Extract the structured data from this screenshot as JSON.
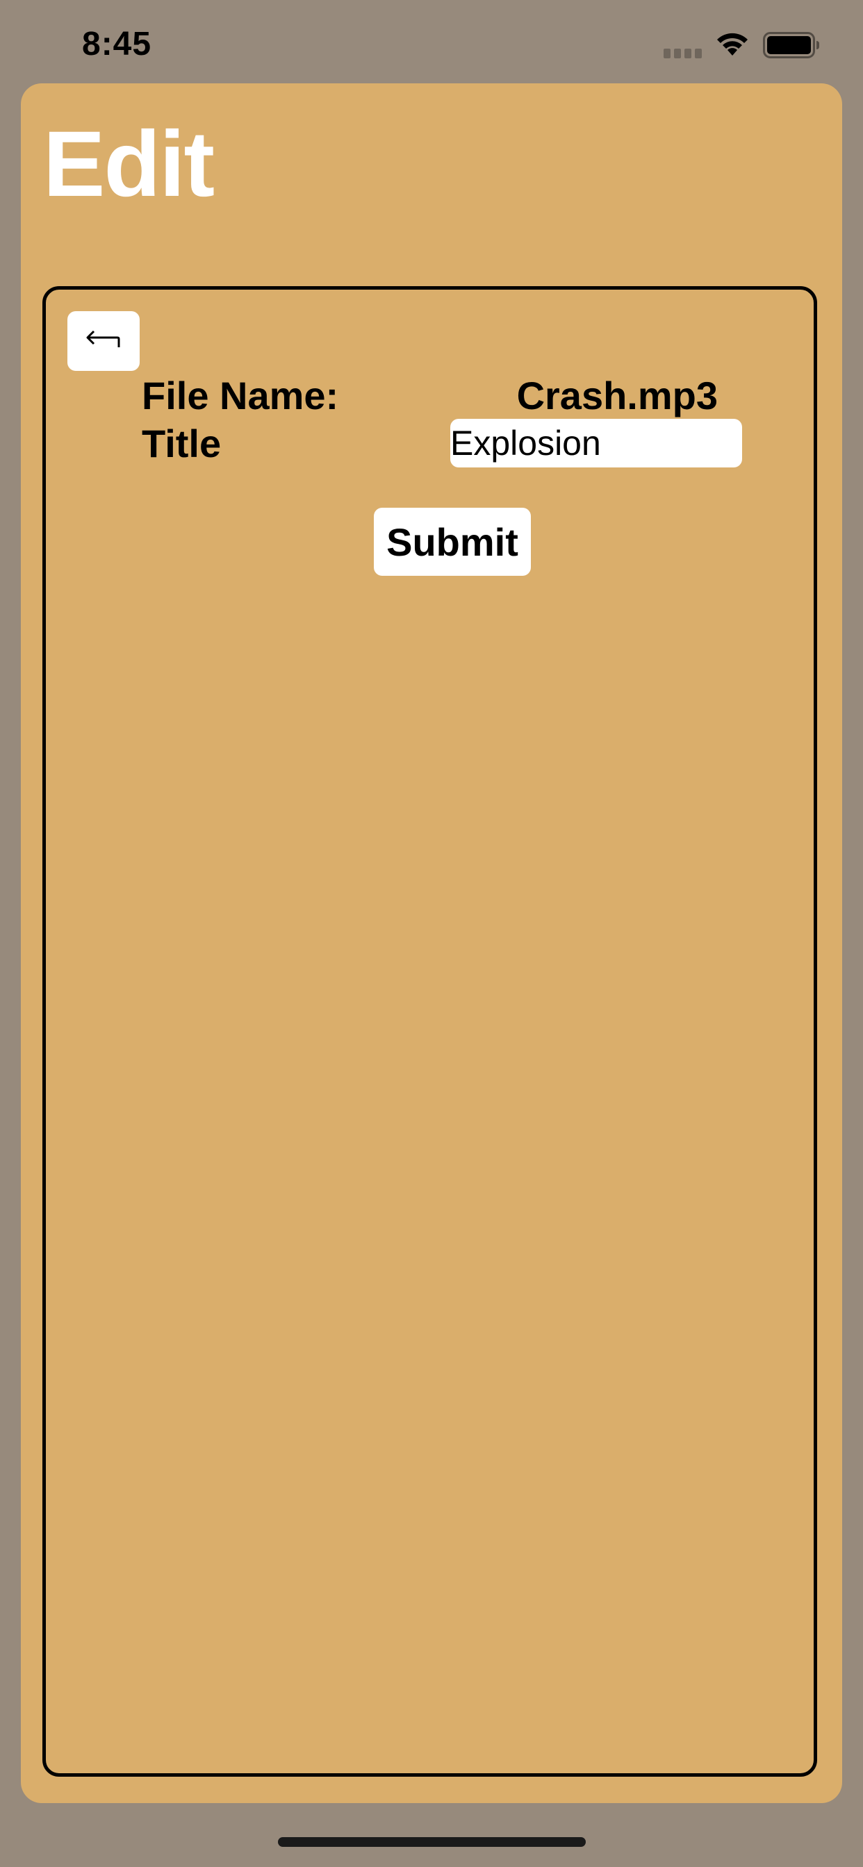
{
  "status_bar": {
    "time": "8:45"
  },
  "screen": {
    "title": "Edit"
  },
  "form": {
    "back_icon": "return-arrow-icon",
    "file_name_label": "File Name:",
    "file_name_value": "Crash.mp3",
    "title_label": "Title",
    "title_value": "Explosion",
    "submit_label": "Submit"
  },
  "colors": {
    "background": "#978a7c",
    "sheet": "#daae6b",
    "title_text": "#ffffff"
  }
}
